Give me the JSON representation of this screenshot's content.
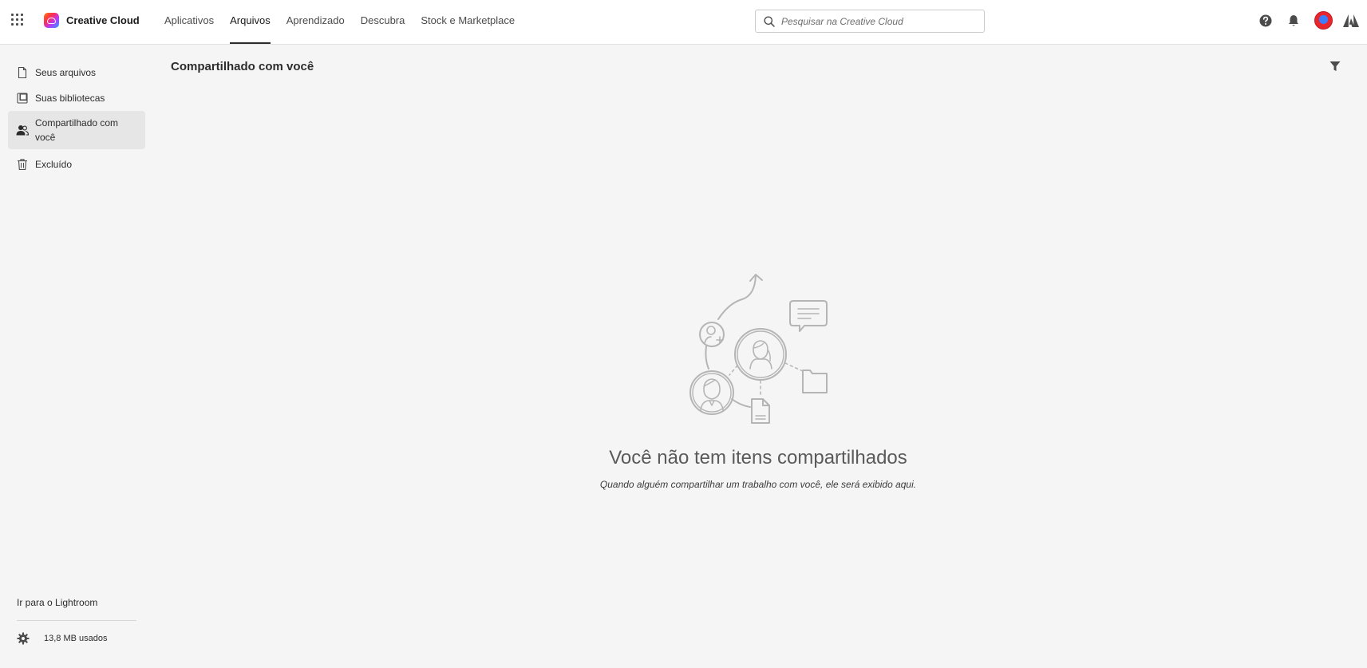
{
  "header": {
    "brand_name": "Creative Cloud",
    "tabs": [
      {
        "label": "Aplicativos"
      },
      {
        "label": "Arquivos",
        "active": true
      },
      {
        "label": "Aprendizado"
      },
      {
        "label": "Descubra"
      },
      {
        "label": "Stock e Marketplace"
      }
    ],
    "search_placeholder": "Pesquisar na Creative Cloud",
    "icons": [
      "app-switcher-icon",
      "help-icon",
      "bell-icon",
      "avatar",
      "adobe-logo-icon"
    ]
  },
  "sidebar": {
    "items": [
      {
        "label": "Seus arquivos",
        "icon": "file-icon"
      },
      {
        "label": "Suas bibliotecas",
        "icon": "library-icon"
      },
      {
        "label": "Compartilhado com você",
        "icon": "people-icon",
        "active": true
      },
      {
        "label": "Excluído",
        "icon": "trash-icon"
      }
    ],
    "lightroom_link": "Ir para o Lightroom",
    "storage_text": "13,8 MB usados"
  },
  "main": {
    "title": "Compartilhado com você",
    "empty_title": "Você não tem itens compartilhados",
    "empty_subtitle": "Quando alguém compartilhar um trabalho com você, ele será exibido aqui."
  },
  "colors": {
    "header_bg": "#ffffff",
    "page_bg": "#f5f5f5",
    "active_item_bg": "#e6e6e6",
    "illustration_stroke": "#b5b5b5"
  }
}
